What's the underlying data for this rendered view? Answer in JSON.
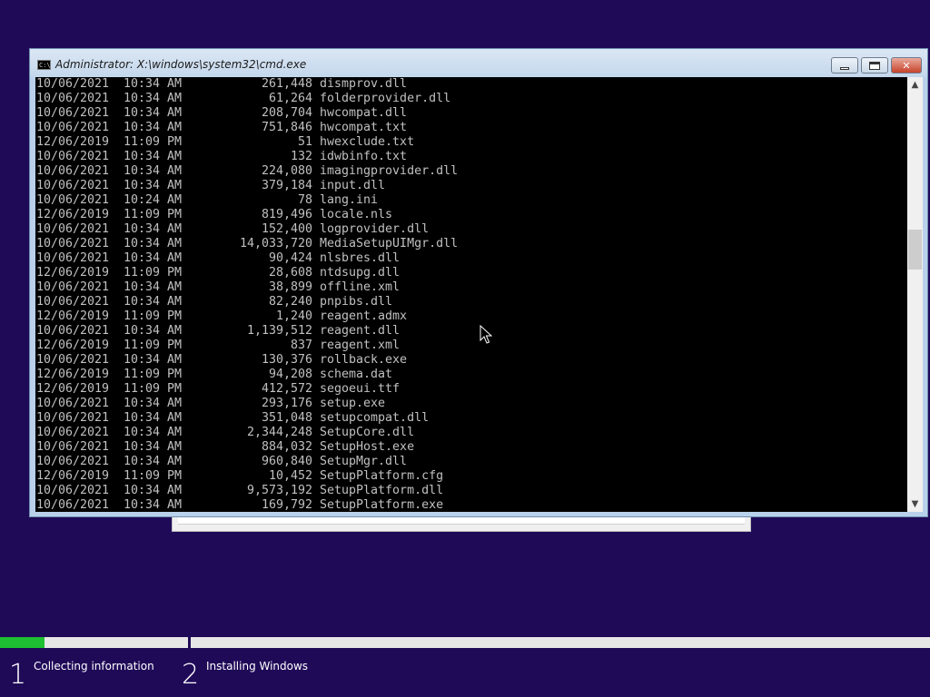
{
  "window": {
    "title": "Administrator: X:\\windows\\system32\\cmd.exe",
    "icon": "console-icon",
    "controls": {
      "minimize": "minimize-icon",
      "maximize": "maximize-icon",
      "close": "close-icon"
    }
  },
  "console": {
    "lines": [
      {
        "date": "10/06/2021",
        "time": "10:34 AM",
        "size": "261,448",
        "name": "dismprov.dll"
      },
      {
        "date": "10/06/2021",
        "time": "10:34 AM",
        "size": "61,264",
        "name": "folderprovider.dll"
      },
      {
        "date": "10/06/2021",
        "time": "10:34 AM",
        "size": "208,704",
        "name": "hwcompat.dll"
      },
      {
        "date": "10/06/2021",
        "time": "10:34 AM",
        "size": "751,846",
        "name": "hwcompat.txt"
      },
      {
        "date": "12/06/2019",
        "time": "11:09 PM",
        "size": "51",
        "name": "hwexclude.txt"
      },
      {
        "date": "10/06/2021",
        "time": "10:34 AM",
        "size": "132",
        "name": "idwbinfo.txt"
      },
      {
        "date": "10/06/2021",
        "time": "10:34 AM",
        "size": "224,080",
        "name": "imagingprovider.dll"
      },
      {
        "date": "10/06/2021",
        "time": "10:34 AM",
        "size": "379,184",
        "name": "input.dll"
      },
      {
        "date": "10/06/2021",
        "time": "10:24 AM",
        "size": "78",
        "name": "lang.ini"
      },
      {
        "date": "12/06/2019",
        "time": "11:09 PM",
        "size": "819,496",
        "name": "locale.nls"
      },
      {
        "date": "10/06/2021",
        "time": "10:34 AM",
        "size": "152,400",
        "name": "logprovider.dll"
      },
      {
        "date": "10/06/2021",
        "time": "10:34 AM",
        "size": "14,033,720",
        "name": "MediaSetupUIMgr.dll"
      },
      {
        "date": "10/06/2021",
        "time": "10:34 AM",
        "size": "90,424",
        "name": "nlsbres.dll"
      },
      {
        "date": "12/06/2019",
        "time": "11:09 PM",
        "size": "28,608",
        "name": "ntdsupg.dll"
      },
      {
        "date": "10/06/2021",
        "time": "10:34 AM",
        "size": "38,899",
        "name": "offline.xml"
      },
      {
        "date": "10/06/2021",
        "time": "10:34 AM",
        "size": "82,240",
        "name": "pnpibs.dll"
      },
      {
        "date": "12/06/2019",
        "time": "11:09 PM",
        "size": "1,240",
        "name": "reagent.admx"
      },
      {
        "date": "10/06/2021",
        "time": "10:34 AM",
        "size": "1,139,512",
        "name": "reagent.dll"
      },
      {
        "date": "12/06/2019",
        "time": "11:09 PM",
        "size": "837",
        "name": "reagent.xml"
      },
      {
        "date": "10/06/2021",
        "time": "10:34 AM",
        "size": "130,376",
        "name": "rollback.exe"
      },
      {
        "date": "12/06/2019",
        "time": "11:09 PM",
        "size": "94,208",
        "name": "schema.dat"
      },
      {
        "date": "12/06/2019",
        "time": "11:09 PM",
        "size": "412,572",
        "name": "segoeui.ttf"
      },
      {
        "date": "10/06/2021",
        "time": "10:34 AM",
        "size": "293,176",
        "name": "setup.exe"
      },
      {
        "date": "10/06/2021",
        "time": "10:34 AM",
        "size": "351,048",
        "name": "setupcompat.dll"
      },
      {
        "date": "10/06/2021",
        "time": "10:34 AM",
        "size": "2,344,248",
        "name": "SetupCore.dll"
      },
      {
        "date": "10/06/2021",
        "time": "10:34 AM",
        "size": "884,032",
        "name": "SetupHost.exe"
      },
      {
        "date": "10/06/2021",
        "time": "10:34 AM",
        "size": "960,840",
        "name": "SetupMgr.dll"
      },
      {
        "date": "12/06/2019",
        "time": "11:09 PM",
        "size": "10,452",
        "name": "SetupPlatform.cfg"
      },
      {
        "date": "10/06/2021",
        "time": "10:34 AM",
        "size": "9,573,192",
        "name": "SetupPlatform.dll"
      },
      {
        "date": "10/06/2021",
        "time": "10:34 AM",
        "size": "169,792",
        "name": "SetupPlatform.exe"
      }
    ]
  },
  "setup": {
    "progress_fraction": 0.048,
    "steps": [
      {
        "number": "1",
        "label": "Collecting information"
      },
      {
        "number": "2",
        "label": "Installing Windows"
      }
    ]
  },
  "colors": {
    "desktop": "#1f0a58",
    "progress": "#1fbf32",
    "console_text": "#c0c0c0"
  }
}
